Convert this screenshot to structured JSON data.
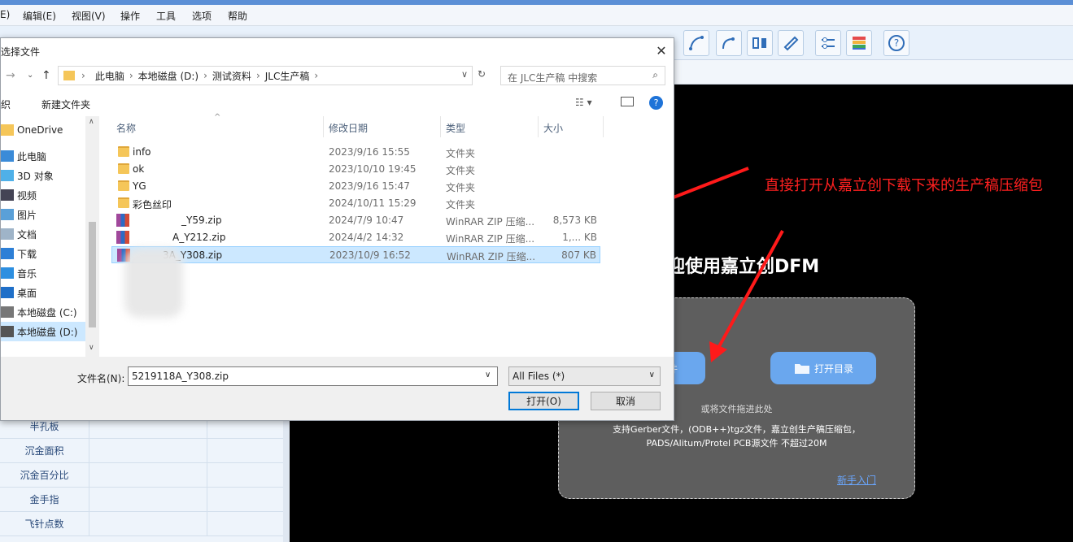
{
  "app": {
    "menu": [
      "E)",
      "编辑(E)",
      "视图(V)",
      "操作",
      "工具",
      "选项",
      "帮助"
    ],
    "welcome": "迎使用嘉立创DFM",
    "dropzone": {
      "btn_left": "件",
      "btn_right": "打开目录",
      "drag_hint": "或将文件拖进此处",
      "support_line1": "支持Gerber文件，(ODB++)tgz文件，嘉立创生产稿压缩包，",
      "support_line2": "PADS/Alitum/Protel PCB源文件 不超过20M",
      "newbie_link": "新手入门"
    },
    "left_rows": [
      "半孔板",
      "沉金面积",
      "沉金百分比",
      "金手指",
      "飞针点数"
    ],
    "annotation": "直接打开从嘉立创下载下来的生产稿压缩包",
    "colors": {
      "accent": "#0078d7",
      "annotation": "#ff2020",
      "canvas": "#000000",
      "dropzone_btn": "#6aa7ee"
    }
  },
  "dialog": {
    "title": "选择文件",
    "breadcrumb": [
      "此电脑",
      "本地磁盘 (D:)",
      "测试资料",
      "JLC生产稿"
    ],
    "search_placeholder": "在 JLC生产稿 中搜索",
    "cmd_left": "织",
    "new_folder": "新建文件夹",
    "nav_items": [
      {
        "label": "OneDrive",
        "icon": "cloud-icon"
      },
      {
        "label": "此电脑",
        "icon": "computer-icon"
      },
      {
        "label": "3D 对象",
        "icon": "cube-icon"
      },
      {
        "label": "视频",
        "icon": "video-icon"
      },
      {
        "label": "图片",
        "icon": "picture-icon"
      },
      {
        "label": "文档",
        "icon": "document-icon"
      },
      {
        "label": "下载",
        "icon": "download-icon"
      },
      {
        "label": "音乐",
        "icon": "music-icon"
      },
      {
        "label": "桌面",
        "icon": "desktop-icon"
      },
      {
        "label": "本地磁盘 (C:)",
        "icon": "drive-icon"
      },
      {
        "label": "本地磁盘 (D:)",
        "icon": "drive-icon"
      }
    ],
    "columns": {
      "name": "名称",
      "date": "修改日期",
      "type": "类型",
      "size": "大小"
    },
    "files": [
      {
        "name": "info",
        "date": "2023/9/16 15:55",
        "type": "文件夹",
        "size": "",
        "kind": "folder"
      },
      {
        "name": "ok",
        "date": "2023/10/10 19:45",
        "type": "文件夹",
        "size": "",
        "kind": "folder"
      },
      {
        "name": "YG",
        "date": "2023/9/16 15:47",
        "type": "文件夹",
        "size": "",
        "kind": "folder"
      },
      {
        "name": "彩色丝印",
        "date": "2024/10/11 15:29",
        "type": "文件夹",
        "size": "",
        "kind": "folder"
      },
      {
        "name": "_Y59.zip",
        "date": "2024/7/9 10:47",
        "type": "WinRAR ZIP 压缩...",
        "size": "8,573 KB",
        "kind": "zip"
      },
      {
        "name": "A_Y212.zip",
        "date": "2024/4/2 14:32",
        "type": "WinRAR ZIP 压缩...",
        "size": "1,... KB",
        "kind": "zip"
      },
      {
        "name": "3A_Y308.zip",
        "date": "2023/10/9 16:52",
        "type": "WinRAR ZIP 压缩...",
        "size": "807 KB",
        "kind": "zip",
        "selected": true
      }
    ],
    "filename_label": "文件名(N):",
    "filename_value": "5219118A_Y308.zip",
    "filetype": "All Files (*)",
    "open_button": "打开(O)",
    "cancel_button": "取消"
  }
}
